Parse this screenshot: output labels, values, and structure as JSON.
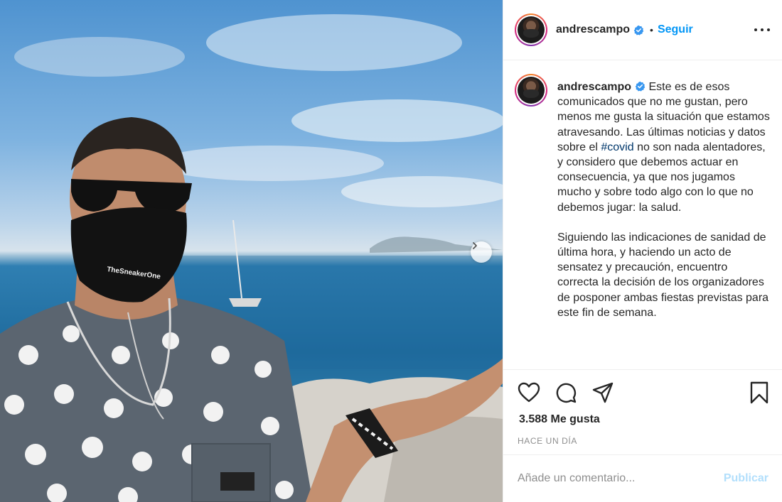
{
  "post": {
    "username": "andrescampo",
    "follow_label": "Seguir",
    "separator": "•",
    "caption_paragraph_1_before_tag": "Este es de esos comunicados que no me gustan, pero menos me gusta la situación que estamos atravesando. Las últimas noticias y datos sobre el ",
    "hashtag": "#covid",
    "caption_paragraph_1_after_tag": " no son nada alentadores, y considero que debemos actuar en consecuencia, ya que nos jugamos mucho y sobre todo algo con lo que no debemos jugar: la salud.",
    "caption_paragraph_2": "Siguiendo las indicaciones de sanidad de última hora, y haciendo un acto de sensatez y precaución, encuentro correcta la decisión de los organizadores de posponer ambas fiestas previstas para este fin de semana.",
    "likes": "3.588 Me gusta",
    "timestamp": "Hace un día"
  },
  "photo": {
    "mask_text": "TheSneakerOne"
  },
  "comment": {
    "placeholder": "Añade un comentario...",
    "publish_label": "Publicar"
  },
  "colors": {
    "accent": "#0095f6",
    "hashtag": "#00376b",
    "publish_disabled": "#b2dffc",
    "muted": "#8e8e8e"
  },
  "icons": [
    "chevron-right-icon",
    "verified-badge-icon",
    "more-options-icon",
    "heart-icon",
    "comment-icon",
    "share-icon",
    "bookmark-icon"
  ]
}
